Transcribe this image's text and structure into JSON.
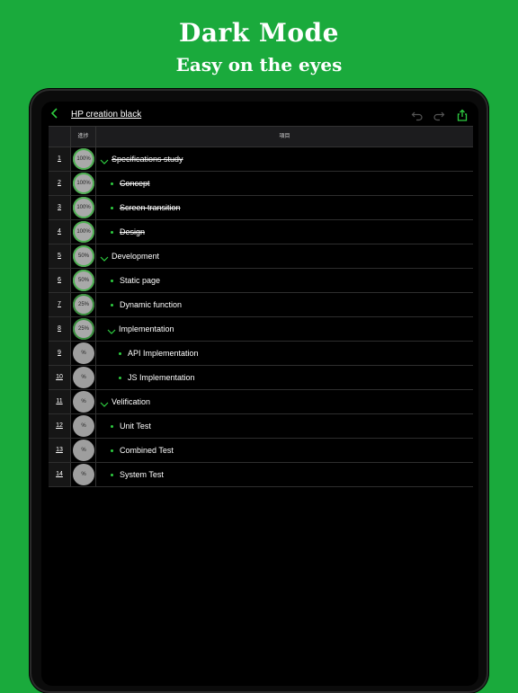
{
  "promo": {
    "title": "Dark Mode",
    "subtitle": "Easy on the eyes"
  },
  "toolbar": {
    "doc_title": "HP creation black",
    "icons": [
      "back-chevron-icon",
      "undo-icon",
      "redo-icon",
      "share-icon"
    ],
    "accent_color": "#2ecc40"
  },
  "table": {
    "headers": {
      "progress": "進捗",
      "item": "項目"
    },
    "rows": [
      {
        "num": "1",
        "progress": "100%",
        "label": "Specifications study",
        "level": 0,
        "expandable": true,
        "done": true
      },
      {
        "num": "2",
        "progress": "100%",
        "label": "Concept",
        "level": 1,
        "expandable": false,
        "done": true
      },
      {
        "num": "3",
        "progress": "100%",
        "label": "Screen transition",
        "level": 1,
        "expandable": false,
        "done": true
      },
      {
        "num": "4",
        "progress": "100%",
        "label": "Design",
        "level": 1,
        "expandable": false,
        "done": true
      },
      {
        "num": "5",
        "progress": "50%",
        "label": "Development",
        "level": 0,
        "expandable": true,
        "done": false
      },
      {
        "num": "6",
        "progress": "50%",
        "label": "Static page",
        "level": 1,
        "expandable": false,
        "done": false
      },
      {
        "num": "7",
        "progress": "25%",
        "label": "Dynamic function",
        "level": 1,
        "expandable": false,
        "done": false
      },
      {
        "num": "8",
        "progress": "25%",
        "label": "Implementation",
        "level": 1,
        "expandable": true,
        "done": false
      },
      {
        "num": "9",
        "progress": "%",
        "label": "API Implementation",
        "level": 2,
        "expandable": false,
        "done": false
      },
      {
        "num": "10",
        "progress": "%",
        "label": "JS Implementation",
        "level": 2,
        "expandable": false,
        "done": false
      },
      {
        "num": "11",
        "progress": "%",
        "label": "Velification",
        "level": 0,
        "expandable": true,
        "done": false
      },
      {
        "num": "12",
        "progress": "%",
        "label": "Unit Test",
        "level": 1,
        "expandable": false,
        "done": false
      },
      {
        "num": "13",
        "progress": "%",
        "label": "Combined Test",
        "level": 1,
        "expandable": false,
        "done": false
      },
      {
        "num": "14",
        "progress": "%",
        "label": "System Test",
        "level": 1,
        "expandable": false,
        "done": false
      }
    ]
  }
}
